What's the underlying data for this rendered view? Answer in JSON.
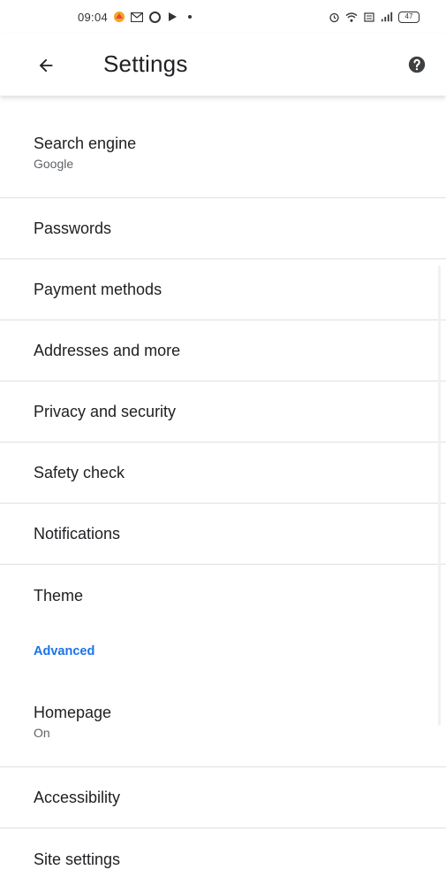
{
  "status_bar": {
    "time": "09:04",
    "left_icons": [
      "app-icon",
      "gmail-icon",
      "opera-icon",
      "play-icon",
      "dot-icon"
    ],
    "right_icons": [
      "alarm-icon",
      "wifi-icon",
      "data-icon",
      "signal-icon"
    ],
    "battery_text": "47"
  },
  "toolbar": {
    "title": "Settings",
    "back_icon": "arrow-back-icon",
    "help_icon": "help-icon"
  },
  "colors": {
    "accent": "#1a73e8",
    "text_primary": "#202124",
    "text_secondary": "#5f6368",
    "divider": "#e0e0e0"
  },
  "items": [
    {
      "title": "Search engine",
      "subtitle": "Google"
    },
    {
      "title": "Passwords"
    },
    {
      "title": "Payment methods"
    },
    {
      "title": "Addresses and more"
    },
    {
      "title": "Privacy and security"
    },
    {
      "title": "Safety check"
    },
    {
      "title": "Notifications"
    },
    {
      "title": "Theme"
    }
  ],
  "section_header": "Advanced",
  "advanced_items": [
    {
      "title": "Homepage",
      "subtitle": "On"
    },
    {
      "title": "Accessibility"
    },
    {
      "title": "Site settings"
    }
  ]
}
